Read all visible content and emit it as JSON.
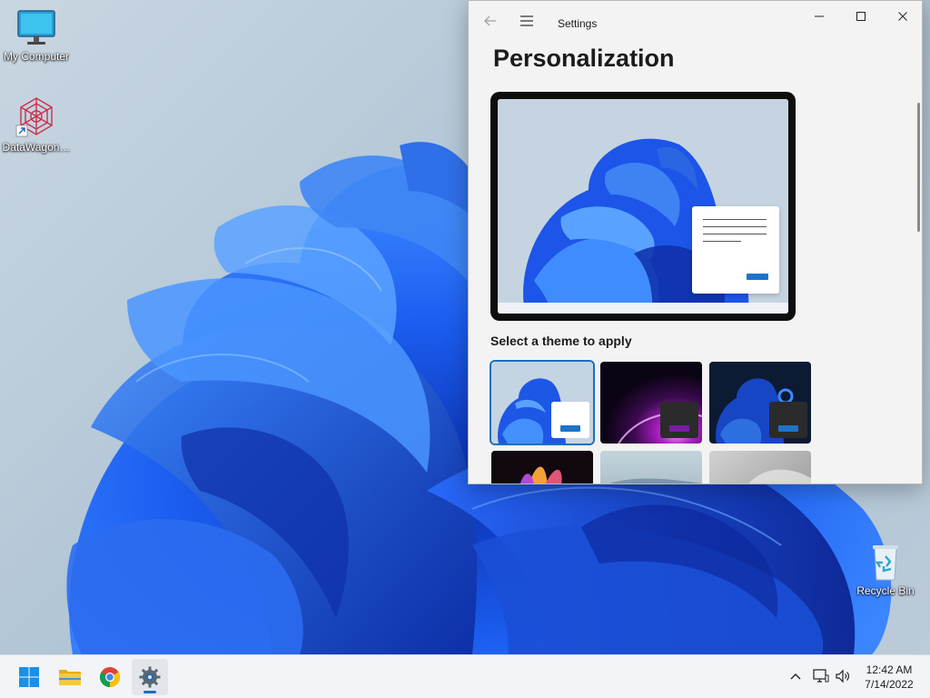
{
  "desktop": {
    "icons": [
      {
        "label": "My Computer",
        "icon": "monitor-icon"
      },
      {
        "label": "DataWagon…",
        "icon": "datawagon-shortcut-icon"
      },
      {
        "label": "Recycle Bin",
        "icon": "recycle-bin-icon"
      }
    ]
  },
  "settings": {
    "app_title": "Settings",
    "page_title": "Personalization",
    "theme_section_heading": "Select a theme to apply",
    "themes": [
      {
        "name": "windows-light-theme",
        "selected": true
      },
      {
        "name": "glow-theme",
        "selected": false
      },
      {
        "name": "windows-dark-theme",
        "selected": false
      },
      {
        "name": "captured-motion-theme",
        "selected": false
      },
      {
        "name": "sunrise-theme",
        "selected": false
      },
      {
        "name": "flow-theme",
        "selected": false
      }
    ],
    "accent_color": "#1a6fc0"
  },
  "taskbar": {
    "apps": [
      {
        "name": "start-button",
        "icon": "windows-logo-icon"
      },
      {
        "name": "file-explorer",
        "icon": "folder-icon"
      },
      {
        "name": "chrome",
        "icon": "chrome-icon"
      },
      {
        "name": "settings",
        "icon": "gear-icon",
        "active": true
      }
    ],
    "clock": {
      "time": "12:42 AM",
      "date": "7/14/2022"
    }
  }
}
